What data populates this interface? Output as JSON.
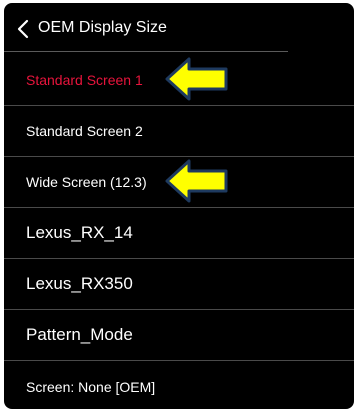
{
  "header": {
    "title": "OEM Display Size",
    "back_icon": "chevron-left-icon"
  },
  "items": [
    {
      "label": "Standard Screen 1"
    },
    {
      "label": "Standard Screen 2"
    },
    {
      "label": "Wide Screen (12.3)"
    },
    {
      "label": "Lexus_RX_14"
    },
    {
      "label": "Lexus_RX350"
    },
    {
      "label": "Pattern_Mode"
    },
    {
      "label": "Screen: None [OEM]"
    }
  ],
  "selected_index": 0,
  "colors": {
    "selected_text": "#e8143c",
    "arrow_fill": "#ffff00",
    "arrow_stroke": "#1e3a5f",
    "background": "#000000"
  },
  "annotation_icons": [
    "yellow-arrow-left-icon",
    "yellow-arrow-left-icon"
  ]
}
